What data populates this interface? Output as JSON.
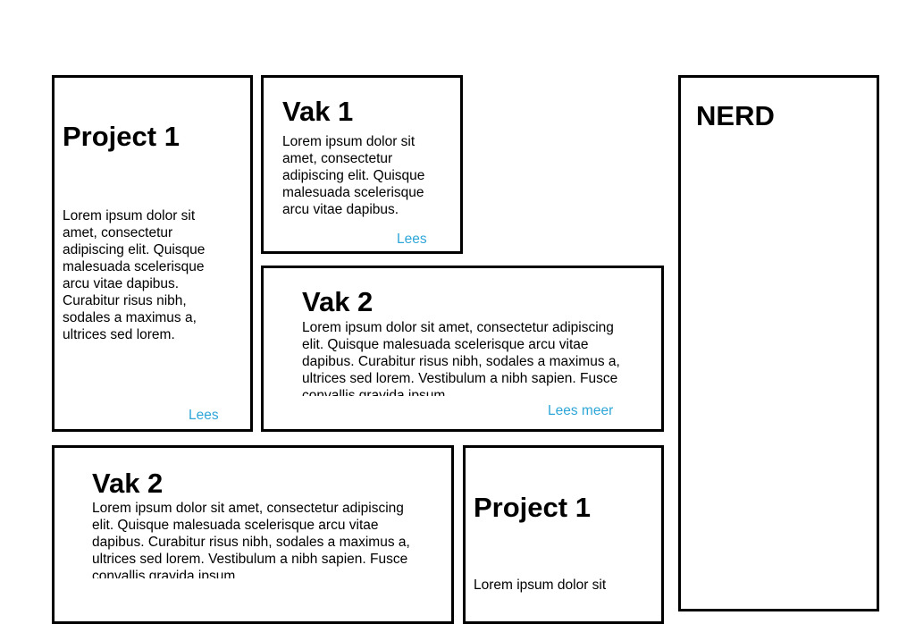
{
  "project_card": {
    "title": "Project 1",
    "text": "Lorem ipsum dolor sit amet, consectetur adipiscing elit. Quisque malesuada scelerisque arcu vitae dapibus. Curabitur risus nibh, sodales a maximus a, ultrices sed lorem.",
    "link": "Lees"
  },
  "vak1_card": {
    "title": "Vak 1",
    "text": "Lorem ipsum dolor sit amet, consectetur adipiscing elit. Quisque malesuada scelerisque arcu vitae dapibus.",
    "link": "Lees"
  },
  "vak2_card": {
    "title": "Vak 2",
    "text": "Lorem ipsum dolor sit amet, consectetur adipiscing elit. Quisque malesuada scelerisque arcu vitae dapibus. Curabitur risus nibh, sodales a maximus a, ultrices sed lorem. Vestibulum a nibh sapien. Fusce convallis gravida ipsum.",
    "link": "Lees meer"
  },
  "vak2_bottom_card": {
    "title": "Vak 2",
    "text": "Lorem ipsum dolor sit amet, consectetur adipiscing elit. Quisque malesuada scelerisque arcu vitae dapibus. Curabitur risus nibh, sodales a maximus a, ultrices sed lorem. Vestibulum a nibh sapien. Fusce convallis gravida ipsum."
  },
  "project_bottom_card": {
    "title": "Project 1",
    "text": "Lorem ipsum dolor sit"
  },
  "nerd_card": {
    "title": "NERD"
  },
  "colors": {
    "link": "#2fa6d8",
    "border": "#000000"
  }
}
